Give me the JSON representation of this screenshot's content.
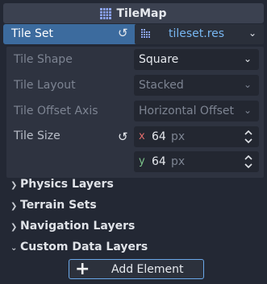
{
  "header": {
    "title": "TileMap",
    "icon": "tilemap-grid-icon"
  },
  "tile_set": {
    "label": "Tile Set",
    "value": "tileset.res",
    "revert_icon": "revert-icon",
    "resource_icon": "tileset-resource-icon"
  },
  "tile_shape": {
    "label": "Tile Shape",
    "value": "Square"
  },
  "tile_layout": {
    "label": "Tile Layout",
    "value": "Stacked"
  },
  "tile_offset_axis": {
    "label": "Tile Offset Axis",
    "value": "Horizontal Offset"
  },
  "tile_size": {
    "label": "Tile Size",
    "x_label": "x",
    "x_value": "64",
    "x_unit": "px",
    "y_label": "y",
    "y_value": "64",
    "y_unit": "px"
  },
  "sections": [
    {
      "label": "Physics Layers",
      "expanded": false
    },
    {
      "label": "Terrain Sets",
      "expanded": false
    },
    {
      "label": "Navigation Layers",
      "expanded": false
    },
    {
      "label": "Custom Data Layers",
      "expanded": true
    }
  ],
  "add_element": {
    "label": "Add Element"
  },
  "colors": {
    "background": "#232834",
    "selected_row": "#3c6b9e",
    "resource_text": "#78b7f2",
    "x_axis": "#e06c6c",
    "y_axis": "#7cc48a",
    "button_border": "#6aa8ea"
  }
}
